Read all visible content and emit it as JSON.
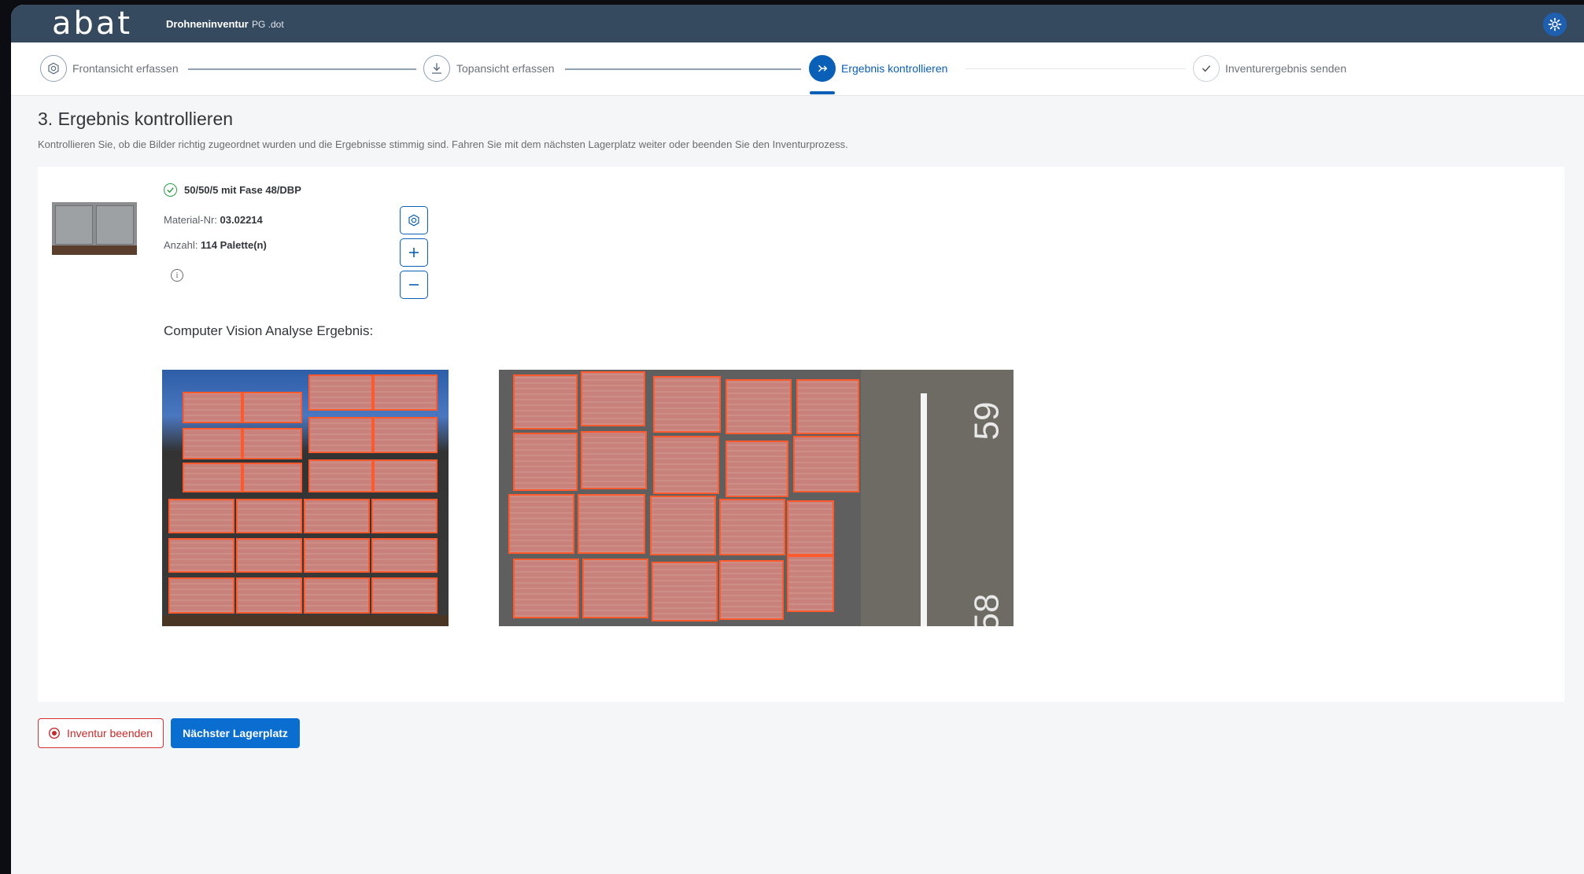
{
  "shell": {
    "logo": "abat",
    "app_title": "Drohneninventur",
    "app_subtitle": "PG .dot",
    "settings_icon": "settings-gear-icon"
  },
  "wizard": {
    "steps": [
      {
        "label": "Frontansicht erfassen",
        "icon": "camera-icon",
        "state": "completed"
      },
      {
        "label": "Topansicht erfassen",
        "icon": "download-icon",
        "state": "completed"
      },
      {
        "label": "Ergebnis kontrollieren",
        "icon": "forward-icon",
        "state": "active"
      },
      {
        "label": "Inventurergebnis senden",
        "icon": "checkmark-icon",
        "state": "pending"
      }
    ]
  },
  "page": {
    "title": "3. Ergebnis kontrollieren",
    "description": "Kontrollieren Sie, ob die Bilder richtig zugeordnet wurden und die Ergebnisse stimmig sind. Fahren Sie mit dem nächsten Lagerplatz weiter oder beenden Sie den Inventurprozess."
  },
  "result": {
    "product_name": "50/50/5 mit Fase 48/DBP",
    "material_label": "Material-Nr:",
    "material_value": "03.02214",
    "count_label": "Anzahl:",
    "count_value": "114 Palette(n)",
    "cv_title": "Computer Vision Analyse Ergebnis:",
    "top_view_markings": [
      "59",
      "58"
    ]
  },
  "actions": {
    "end_label": "Inventur beenden",
    "next_label": "Nächster Lagerplatz"
  },
  "colors": {
    "shell": "#354a5f",
    "accent": "#0a5fb6",
    "detection_box": "#ff5a2e",
    "danger": "#d92f2f"
  }
}
